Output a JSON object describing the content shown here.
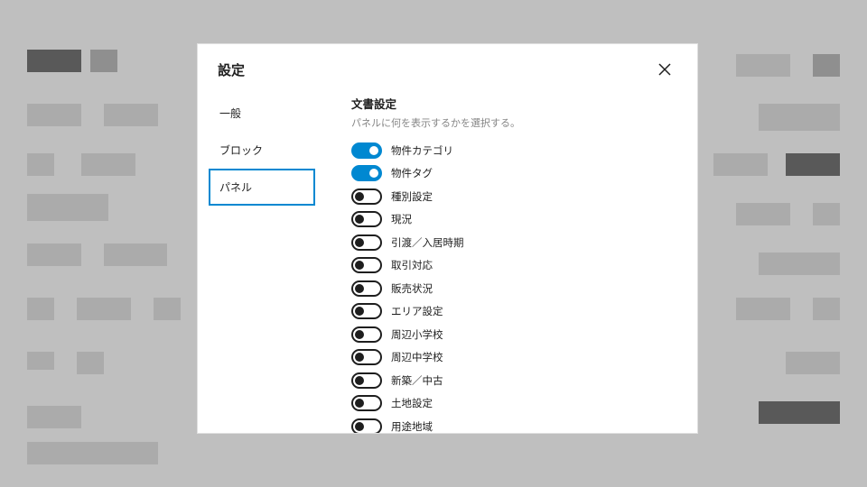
{
  "modal": {
    "title": "設定",
    "tabs": [
      {
        "label": "一般",
        "active": false
      },
      {
        "label": "ブロック",
        "active": false
      },
      {
        "label": "パネル",
        "active": true
      }
    ],
    "section": {
      "title": "文書設定",
      "description": "パネルに何を表示するかを選択する。"
    },
    "toggles": [
      {
        "label": "物件カテゴリ",
        "on": true
      },
      {
        "label": "物件タグ",
        "on": true
      },
      {
        "label": "種別設定",
        "on": false
      },
      {
        "label": "現況",
        "on": false
      },
      {
        "label": "引渡／入居時期",
        "on": false
      },
      {
        "label": "取引対応",
        "on": false
      },
      {
        "label": "販売状況",
        "on": false
      },
      {
        "label": "エリア設定",
        "on": false
      },
      {
        "label": "周辺小学校",
        "on": false
      },
      {
        "label": "周辺中学校",
        "on": false
      },
      {
        "label": "新築／中古",
        "on": false
      },
      {
        "label": "土地設定",
        "on": false
      },
      {
        "label": "用途地域",
        "on": false
      }
    ],
    "accent_color": "#0088d1"
  }
}
